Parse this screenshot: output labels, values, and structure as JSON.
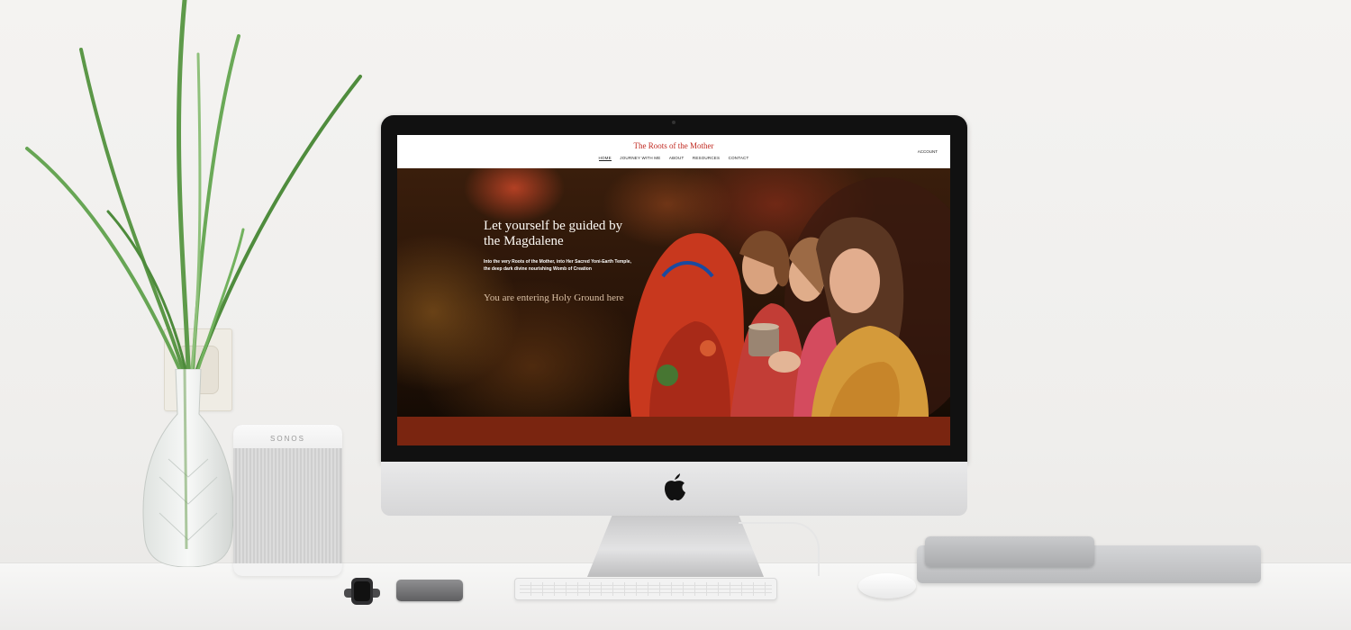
{
  "speaker": {
    "brand": "SONOS"
  },
  "website": {
    "title": "The Roots of the Mother",
    "nav": [
      {
        "label": "HOME",
        "active": true
      },
      {
        "label": "JOURNEY WITH ME",
        "active": false
      },
      {
        "label": "ABOUT",
        "active": false
      },
      {
        "label": "RESOURCES",
        "active": false
      },
      {
        "label": "CONTACT",
        "active": false
      }
    ],
    "account_label": "ACCOUNT",
    "hero": {
      "heading": "Let yourself be guided by the Magdalene",
      "subtext": "Into the very Roots of the Mother, into Her Sacred Yoni-Earth Temple, the deep dark divine nourishing Womb of Creation",
      "tagline": "You are entering Holy Ground here"
    }
  },
  "colors": {
    "title_red": "#c0281f",
    "band_rust": "#7a2510",
    "hero_text": "#fdfaf5",
    "tagline_tan": "#d9bfa4"
  }
}
